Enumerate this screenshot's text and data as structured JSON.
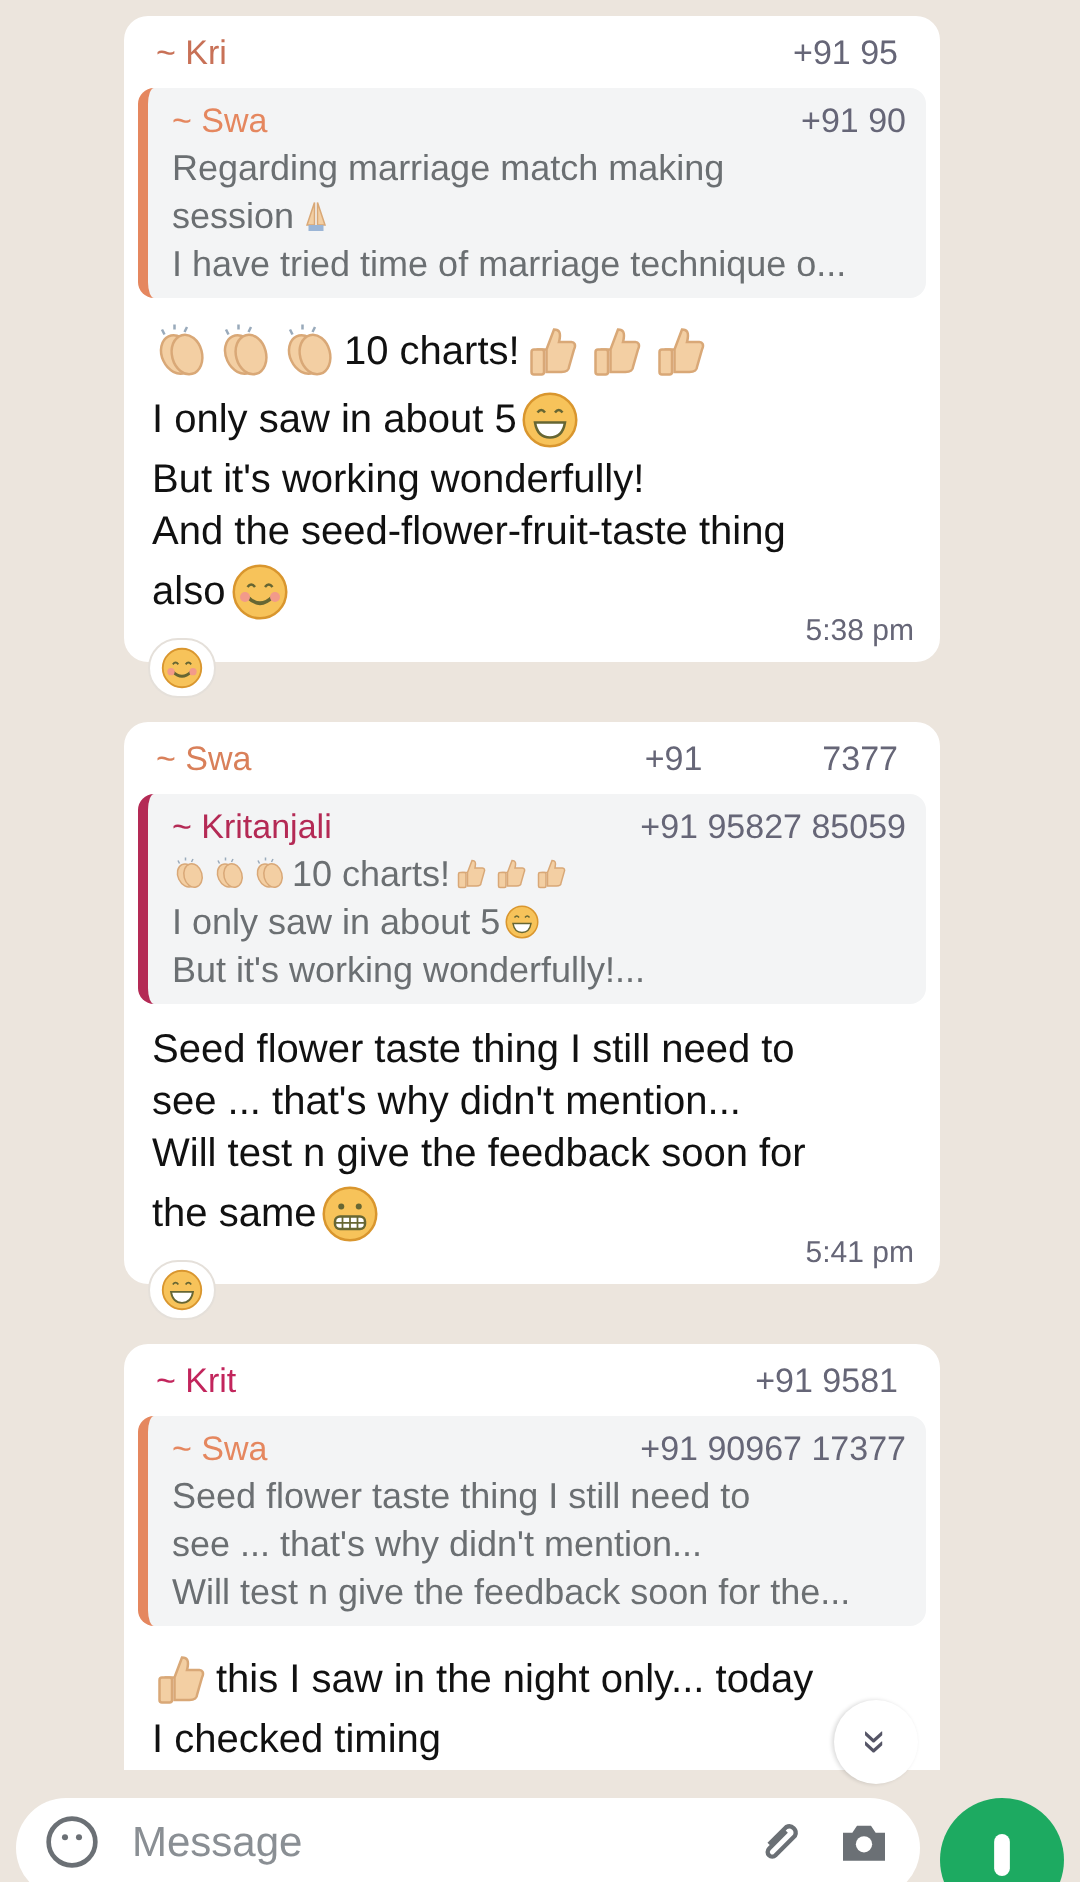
{
  "messages": [
    {
      "sender": {
        "name": "~ Kri",
        "phone": [
          "+91 95"
        ],
        "color": "#c87157"
      },
      "quote": {
        "name": "~ Swa",
        "phone": "+91 90",
        "color": "#e5875f",
        "lines": [
          [
            {
              "kind": "text",
              "text": "Regarding marriage match making"
            }
          ],
          [
            {
              "kind": "text",
              "text": "session"
            },
            {
              "kind": "pray"
            }
          ],
          [
            {
              "kind": "text",
              "text": "I have tried time of marriage technique o..."
            }
          ]
        ]
      },
      "body": [
        [
          {
            "kind": "clap"
          },
          {
            "kind": "clap"
          },
          {
            "kind": "clap"
          },
          {
            "kind": "text",
            "text": "10 charts!"
          },
          {
            "kind": "thumb"
          },
          {
            "kind": "thumb"
          },
          {
            "kind": "thumb"
          }
        ],
        [
          {
            "kind": "text",
            "text": "I only saw in about 5"
          },
          {
            "kind": "grin"
          }
        ],
        [
          {
            "kind": "text",
            "text": "But it's working wonderfully!"
          }
        ],
        [
          {
            "kind": "text",
            "text": "And the seed-flower-fruit-taste thing"
          }
        ],
        [
          {
            "kind": "text",
            "text": "also"
          },
          {
            "kind": "smile"
          }
        ]
      ],
      "time": "5:38 pm",
      "reaction": {
        "kind": "smile"
      }
    },
    {
      "sender": {
        "name": "~ Swa",
        "phone": [
          "+91",
          "7377"
        ],
        "color": "#d9805a"
      },
      "quote": {
        "name": "~ Kritanjali",
        "phone": "+91 95827 85059",
        "color": "#b42a55",
        "lines": [
          [
            {
              "kind": "clap"
            },
            {
              "kind": "clap"
            },
            {
              "kind": "clap"
            },
            {
              "kind": "text",
              "text": "10 charts!"
            },
            {
              "kind": "thumb"
            },
            {
              "kind": "thumb"
            },
            {
              "kind": "thumb"
            }
          ],
          [
            {
              "kind": "text",
              "text": "I only saw in about 5"
            },
            {
              "kind": "grin"
            }
          ],
          [
            {
              "kind": "text",
              "text": "But it's working wonderfully!..."
            }
          ]
        ]
      },
      "body": [
        [
          {
            "kind": "text",
            "text": "Seed flower taste thing I still need to"
          }
        ],
        [
          {
            "kind": "text",
            "text": "see ... that's why  didn't mention..."
          }
        ],
        [
          {
            "kind": "text",
            "text": "Will test n give the feedback soon for"
          }
        ],
        [
          {
            "kind": "text",
            "text": "the same"
          },
          {
            "kind": "grimace"
          }
        ]
      ],
      "time": "5:41 pm",
      "reaction": {
        "kind": "grin"
      }
    },
    {
      "sender": {
        "name": "~ Krit",
        "phone": [
          "+91 9581"
        ],
        "color": "#c2255c"
      },
      "quote": {
        "name": "~ Swa",
        "phone": "+91 90967 17377",
        "color": "#e5875f",
        "lines": [
          [
            {
              "kind": "text",
              "text": "Seed flower taste thing I still need to"
            }
          ],
          [
            {
              "kind": "text",
              "text": "see ... that's why  didn't mention..."
            }
          ],
          [
            {
              "kind": "text",
              "text": "Will test n give the feedback soon for the..."
            }
          ]
        ]
      },
      "body": [
        [
          {
            "kind": "thumb"
          },
          {
            "kind": "text",
            "text": "this I saw in the night only... today"
          }
        ],
        [
          {
            "kind": "text",
            "text": "I checked timing"
          }
        ]
      ]
    }
  ],
  "scroll_button": {
    "label": "»"
  },
  "composer": {
    "placeholder": "Message"
  }
}
